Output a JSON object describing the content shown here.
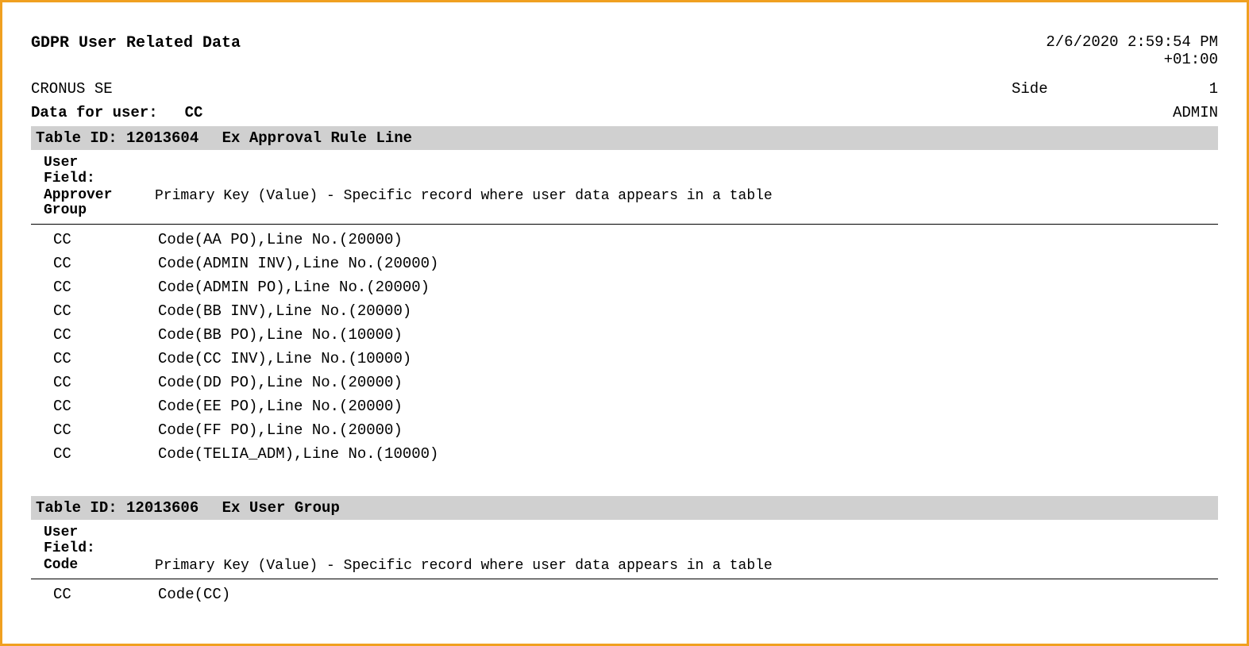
{
  "header": {
    "title": "GDPR User Related Data",
    "datetime": "2/6/2020 2:59:54 PM",
    "tz": "+01:00",
    "company": "CRONUS SE",
    "side_label": "Side",
    "side_value": "1",
    "user_label": "Data for user:",
    "user_value": "CC",
    "admin": "ADMIN"
  },
  "sections": [
    {
      "bar_label": "Table ID: 12013604",
      "bar_name": "Ex Approval Rule Line",
      "user_field_label": "User Field:",
      "field_name": "Approver Group",
      "field_desc": "Primary Key (Value) - Specific record where user data appears in a table",
      "rows": [
        {
          "c1": "CC",
          "c2": "Code(AA PO),Line No.(20000)"
        },
        {
          "c1": "CC",
          "c2": "Code(ADMIN INV),Line No.(20000)"
        },
        {
          "c1": "CC",
          "c2": "Code(ADMIN PO),Line No.(20000)"
        },
        {
          "c1": "CC",
          "c2": "Code(BB INV),Line No.(20000)"
        },
        {
          "c1": "CC",
          "c2": "Code(BB PO),Line No.(10000)"
        },
        {
          "c1": "CC",
          "c2": "Code(CC INV),Line No.(10000)"
        },
        {
          "c1": "CC",
          "c2": "Code(DD PO),Line No.(20000)"
        },
        {
          "c1": "CC",
          "c2": "Code(EE PO),Line No.(20000)"
        },
        {
          "c1": "CC",
          "c2": "Code(FF PO),Line No.(20000)"
        },
        {
          "c1": "CC",
          "c2": "Code(TELIA_ADM),Line No.(10000)"
        }
      ]
    },
    {
      "bar_label": "Table ID: 12013606",
      "bar_name": "Ex User Group",
      "user_field_label": "User Field:",
      "field_name": "Code",
      "field_desc": "Primary Key (Value) - Specific record where user data appears in a table",
      "rows": [
        {
          "c1": "CC",
          "c2": "Code(CC)"
        }
      ]
    }
  ]
}
